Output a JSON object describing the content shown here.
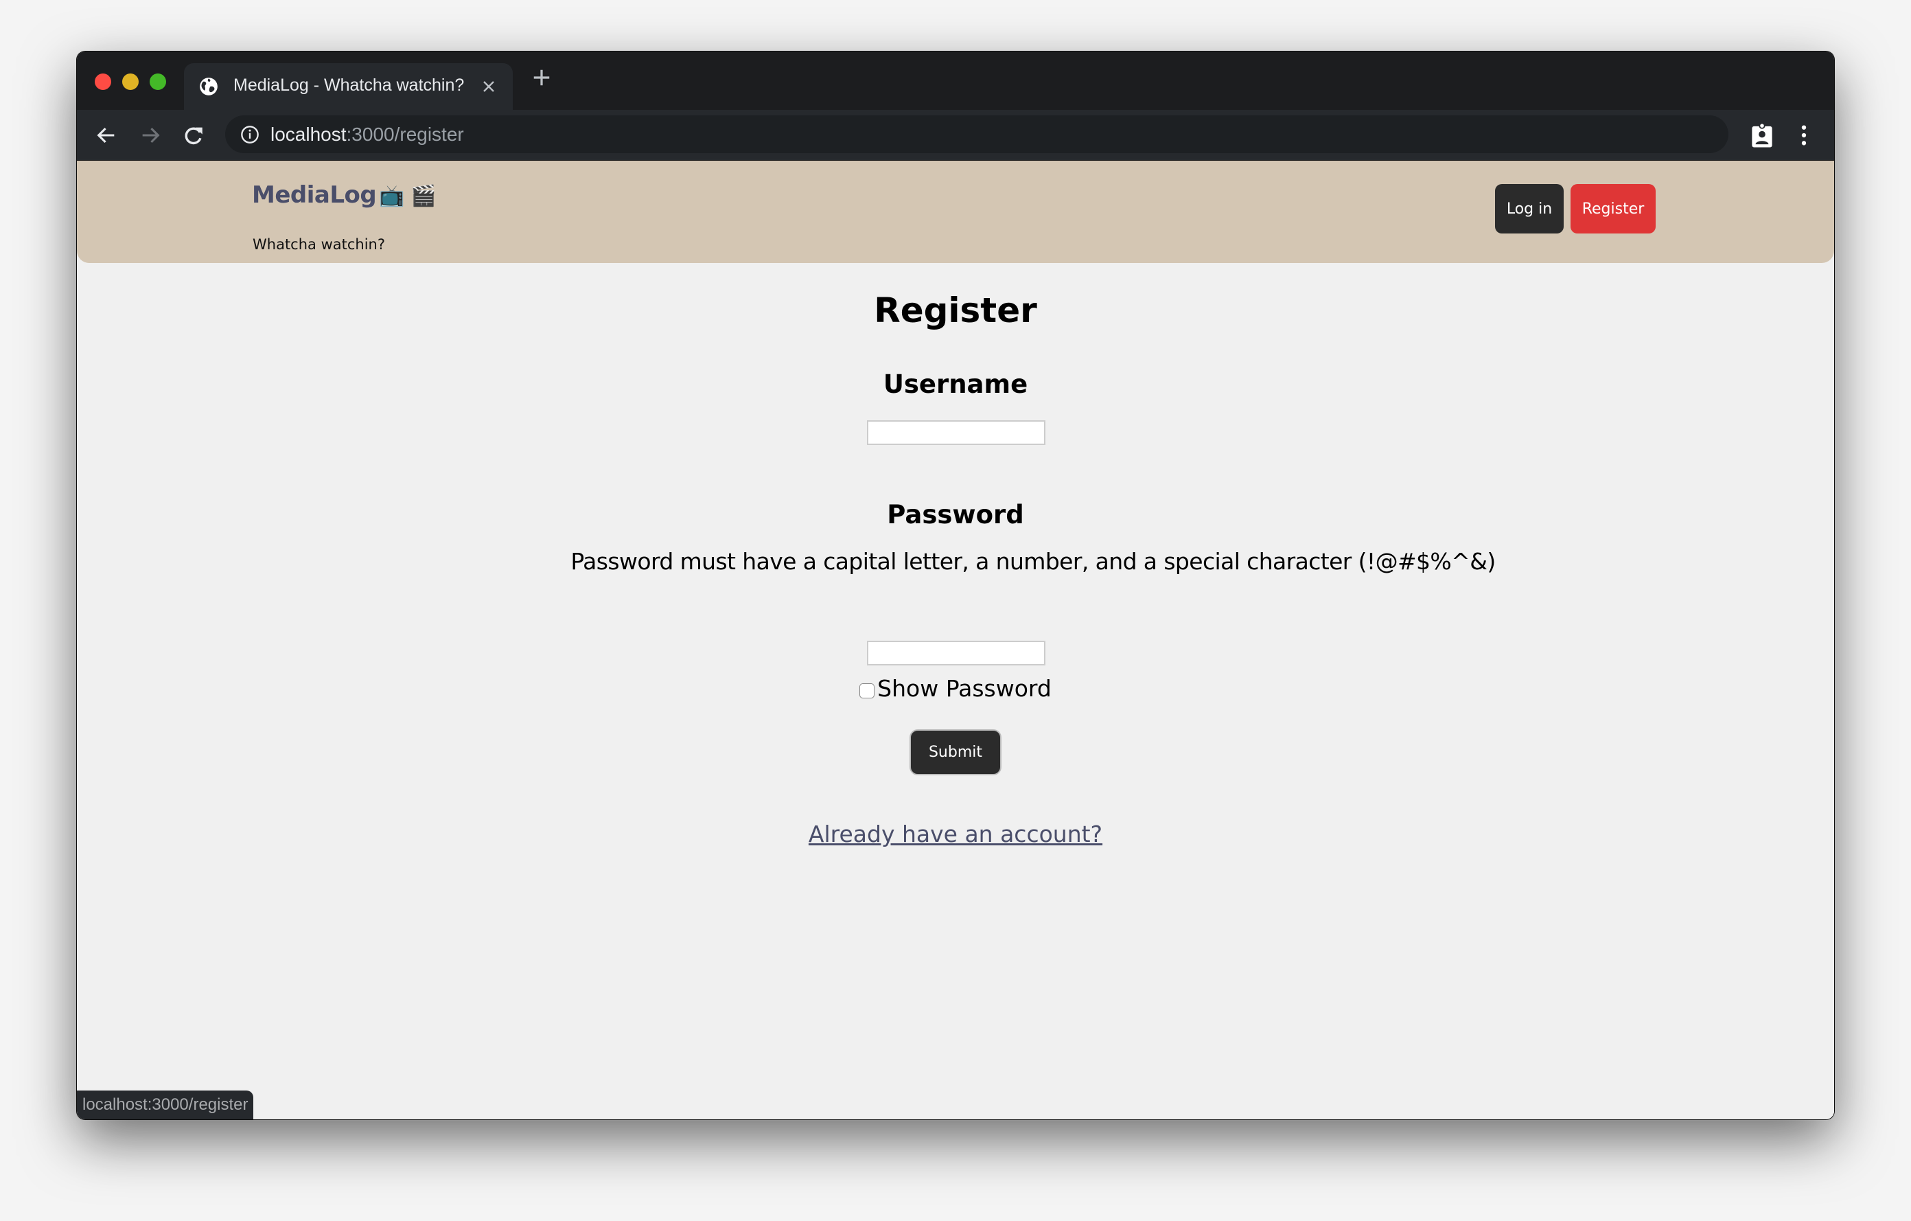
{
  "browser": {
    "tab_title": "MediaLog - Whatcha watchin?",
    "url_host": "localhost",
    "url_path": ":3000/register",
    "status_url": "localhost:3000/register",
    "icons": {
      "favicon": "globe-icon",
      "close": "close-icon",
      "new_tab": "plus-icon",
      "back": "arrow-left-icon",
      "forward": "arrow-right-icon",
      "reload": "reload-icon",
      "site_info": "info-icon",
      "profile": "profile-badge-icon",
      "menu": "kebab-menu-icon"
    }
  },
  "header": {
    "logo": "MediaLog",
    "logo_emojis": "📺 🎬",
    "tagline": "Whatcha watchin?",
    "login_label": "Log in",
    "register_label": "Register",
    "colors": {
      "background": "#d4c6b3",
      "logo": "#4a4e6a",
      "login_button": "#2b2b2b",
      "register_button": "#df3636"
    }
  },
  "form": {
    "title": "Register",
    "username_label": "Username",
    "username_value": "",
    "password_label": "Password",
    "password_hint": "Password must have a capital letter, a number, and a special character (!@#$%^&)",
    "password_value": "",
    "show_password_label": "Show Password",
    "show_password_checked": false,
    "submit_label": "Submit",
    "login_link": "Already have an account?"
  }
}
